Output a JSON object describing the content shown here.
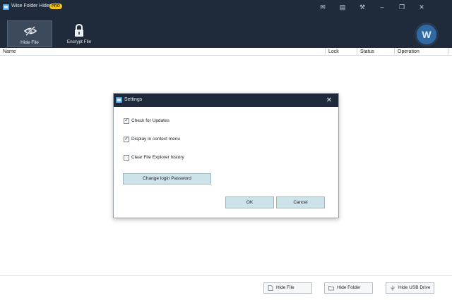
{
  "app": {
    "title": "Wise Folder Hider",
    "badge": "PRO"
  },
  "titlebar_buttons": [
    {
      "name": "mail-icon",
      "glyph": "✉"
    },
    {
      "name": "feedback-icon",
      "glyph": "▤"
    },
    {
      "name": "settings-icon",
      "glyph": "⚒"
    },
    {
      "name": "minimize-icon",
      "glyph": "–"
    },
    {
      "name": "restore-icon",
      "glyph": "❐"
    },
    {
      "name": "close-icon",
      "glyph": "✕"
    }
  ],
  "toolbar": {
    "hide_file_label": "Hide File",
    "encrypt_file_label": "Encrypt File"
  },
  "avatar": {
    "letter": "W"
  },
  "columns": {
    "name": "Name",
    "lock": "Lock",
    "status": "Status",
    "operation": "Operation"
  },
  "dialog": {
    "title": "Settings",
    "close_glyph": "✕",
    "options": [
      {
        "label": "Check for Updates",
        "checked": true
      },
      {
        "label": "Display in context menu",
        "checked": true
      },
      {
        "label": "Clear File Explorer history",
        "checked": false
      }
    ],
    "change_password_label": "Change login Password",
    "ok_label": "OK",
    "cancel_label": "Cancel"
  },
  "footer": {
    "hide_file": "Hide File",
    "hide_folder": "Hide Folder",
    "hide_usb": "Hide USB Drive"
  },
  "colors": {
    "titlebar": "#1f2b3a",
    "accent": "#4fa3e0",
    "dialog_button": "#cde3ea",
    "badge": "#f5c518"
  }
}
